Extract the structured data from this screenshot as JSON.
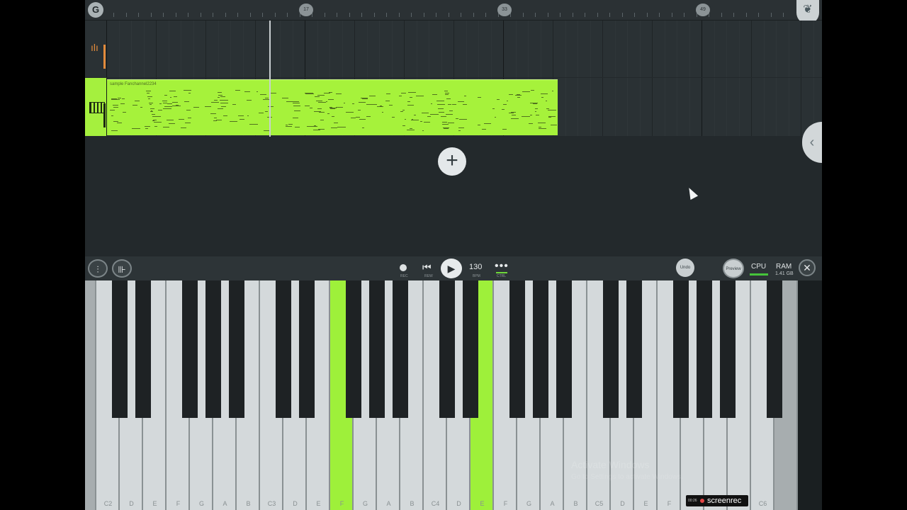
{
  "ruler": {
    "loop_icon": "loop-icon",
    "markers": [
      {
        "label": "17"
      },
      {
        "label": "33"
      },
      {
        "label": "49"
      }
    ],
    "corner_icon": "wing-icon"
  },
  "tracks": [
    {
      "name": "automation-track",
      "icon": "meter-icon",
      "color": "#e38b3b"
    },
    {
      "name": "pattern-track",
      "icon": "piano-icon",
      "color": "#a5f03e"
    }
  ],
  "clip": {
    "label": "sample Fanchannel2234",
    "color": "#a6f23b"
  },
  "add_button": {
    "icon": "plus-icon",
    "label": "+"
  },
  "side_button": {
    "icon": "chevron-left-icon",
    "label": "‹"
  },
  "transport": {
    "mixer_icon": "mixer-icon",
    "piano_roll_icon": "piano-roll-icon",
    "rec_label": "REC",
    "rew_label": "REW",
    "bpm": "130",
    "bpm_label": "BPM",
    "ctrl_label": "CTRL",
    "ctrl_symbol": "•••",
    "undo_label": "Undo",
    "preview_label": "Preview",
    "cpu_label": "CPU",
    "ram_label": "RAM",
    "ram_value": "1.41 GB",
    "close_symbol": "✕",
    "play_symbol": "▶",
    "rewind_symbol": "⏮"
  },
  "keyboard": {
    "white_keys": [
      {
        "label": "",
        "state": "dim"
      },
      {
        "label": "C2",
        "state": "normal"
      },
      {
        "label": "D",
        "state": "normal"
      },
      {
        "label": "E",
        "state": "normal"
      },
      {
        "label": "F",
        "state": "normal"
      },
      {
        "label": "G",
        "state": "normal"
      },
      {
        "label": "A",
        "state": "normal"
      },
      {
        "label": "B",
        "state": "normal"
      },
      {
        "label": "C3",
        "state": "normal"
      },
      {
        "label": "D",
        "state": "normal"
      },
      {
        "label": "E",
        "state": "normal"
      },
      {
        "label": "F",
        "state": "active"
      },
      {
        "label": "G",
        "state": "normal"
      },
      {
        "label": "A",
        "state": "normal"
      },
      {
        "label": "B",
        "state": "normal"
      },
      {
        "label": "C4",
        "state": "normal"
      },
      {
        "label": "D",
        "state": "normal"
      },
      {
        "label": "E",
        "state": "active"
      },
      {
        "label": "F",
        "state": "normal"
      },
      {
        "label": "G",
        "state": "normal"
      },
      {
        "label": "A",
        "state": "normal"
      },
      {
        "label": "B",
        "state": "normal"
      },
      {
        "label": "C5",
        "state": "normal"
      },
      {
        "label": "D",
        "state": "normal"
      },
      {
        "label": "E",
        "state": "normal"
      },
      {
        "label": "F",
        "state": "normal"
      },
      {
        "label": "G",
        "state": "normal"
      },
      {
        "label": "A",
        "state": "normal"
      },
      {
        "label": "B",
        "state": "normal"
      },
      {
        "label": "C6",
        "state": "normal"
      },
      {
        "label": "",
        "state": "dim"
      }
    ]
  },
  "watermark": {
    "title": "Activate Windows",
    "subtitle": "Go to Settings to activate Windows."
  },
  "screenrec": {
    "time": "00:26",
    "label": "screenrec"
  }
}
